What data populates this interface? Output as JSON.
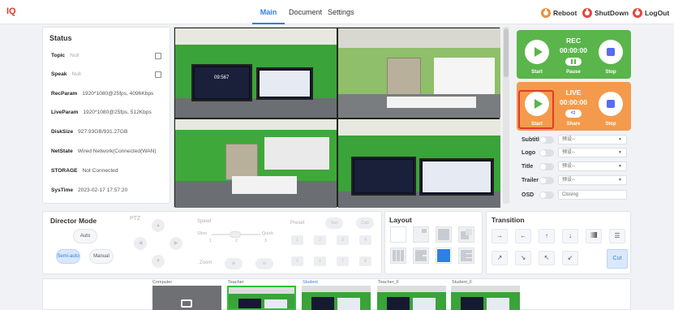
{
  "app": {
    "logo": "IQ"
  },
  "nav": {
    "tabs": [
      "Main",
      "Document",
      "Settings"
    ],
    "active": "Main"
  },
  "top_actions": {
    "reboot": "Reboot",
    "shutdown": "ShutDown",
    "logout": "LogOut",
    "colors": {
      "reboot": "#f28c3a",
      "shutdown": "#e8453c",
      "logout": "#e8453c"
    }
  },
  "status": {
    "title": "Status",
    "rows": [
      {
        "key": "Topic",
        "value": "Null"
      },
      {
        "key": "Speak",
        "value": "Null"
      },
      {
        "key": "RecParam",
        "value": "1920*1080@25fps, 4096Kbps"
      },
      {
        "key": "LiveParam",
        "value": "1920*1080@25fps, 512Kbps"
      },
      {
        "key": "DiskSize",
        "value": "927.93GB/931.27GB"
      },
      {
        "key": "NetState",
        "value": "Wired Network(Connected(WAN)"
      },
      {
        "key": "STORAGE",
        "value": "Not Connected"
      },
      {
        "key": "SysTime",
        "value": "2023-02-17 17:57:20"
      }
    ]
  },
  "rec": {
    "title": "REC",
    "time": "00:00:00",
    "start": "Start",
    "pause": "Pause",
    "stop": "Stop",
    "color": "#5ab54b"
  },
  "live": {
    "title": "LIVE",
    "time": "00:00:00",
    "start": "Start",
    "share": "Share",
    "stop": "Stop",
    "color": "#f39a4c"
  },
  "overlays": {
    "rows": [
      {
        "label": "Subtitl",
        "value": "预设--"
      },
      {
        "label": "Logo",
        "value": "预设--"
      },
      {
        "label": "Title",
        "value": "预设--"
      },
      {
        "label": "Trailer",
        "value": "预设--"
      },
      {
        "label": "OSD",
        "value": "Closing"
      }
    ]
  },
  "director": {
    "title": "Director Mode",
    "modes": [
      "Auto",
      "Semi-auto",
      "Manual"
    ],
    "active_mode": "Semi-auto",
    "ptz_title": "PTZ",
    "speed_label": "Speed",
    "speed_slow": "Slow",
    "speed_quick": "Quick",
    "speed_ticks": [
      "1",
      "2",
      "3"
    ],
    "zoom_label": "Zoom",
    "preset_label": "Preset",
    "set_label": "Set",
    "call_label": "Call",
    "presets": [
      "1",
      "2",
      "3",
      "4",
      "5",
      "6",
      "7",
      "8"
    ]
  },
  "layout_panel": {
    "title": "Layout"
  },
  "transition_panel": {
    "title": "Transition",
    "cut": "Cut"
  },
  "thumbnails": {
    "labels": [
      "Computer",
      "Teacher",
      "Student",
      "Teacher_F",
      "Student_F"
    ]
  },
  "video_screen": {
    "clock": "09:567"
  }
}
